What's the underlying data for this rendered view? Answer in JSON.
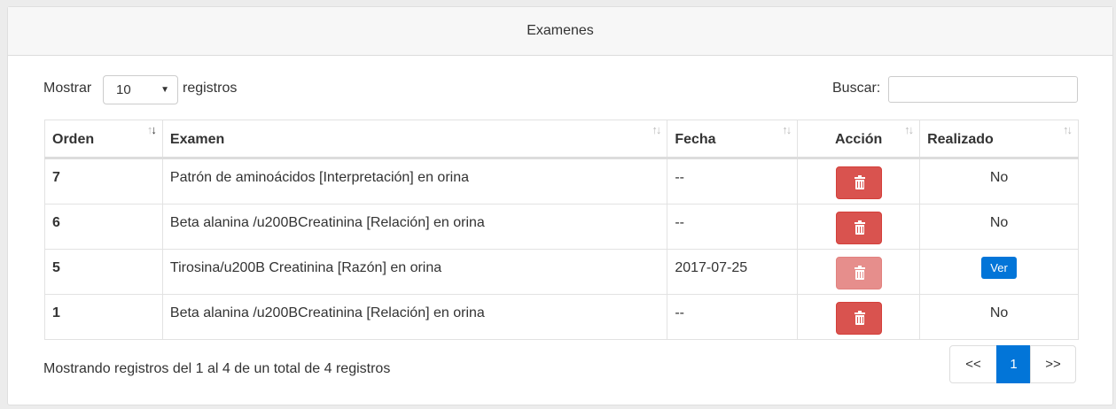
{
  "card": {
    "title": "Examenes"
  },
  "length": {
    "prefix": "Mostrar",
    "value": "10",
    "suffix": "registros"
  },
  "search": {
    "label": "Buscar:",
    "value": ""
  },
  "table": {
    "headers": [
      "Orden",
      "Examen",
      "Fecha",
      "Acción",
      "Realizado"
    ],
    "rows": [
      {
        "orden": "7",
        "examen": "Patrón de aminoácidos [Interpretación] en orina",
        "fecha": "--",
        "accion_enabled": true,
        "realizado": "No"
      },
      {
        "orden": "6",
        "examen": "Beta alanina /u200BCreatinina [Relación] en orina",
        "fecha": "--",
        "accion_enabled": true,
        "realizado": "No"
      },
      {
        "orden": "5",
        "examen": "Tirosina/u200B Creatinina [Razón] en orina",
        "fecha": "2017-07-25",
        "accion_enabled": false,
        "realizado": "Ver"
      },
      {
        "orden": "1",
        "examen": "Beta alanina /u200BCreatinina [Relación] en orina",
        "fecha": "--",
        "accion_enabled": true,
        "realizado": "No"
      }
    ]
  },
  "footer": {
    "info": "Mostrando registros del 1 al 4 de un total de 4 registros",
    "pagination": {
      "prev": "<<",
      "current": "1",
      "next": ">>"
    }
  },
  "colors": {
    "danger": "#d9534f",
    "primary": "#0275d8"
  },
  "icons": {
    "delete": "trash-icon",
    "sort": "sort-icon"
  }
}
